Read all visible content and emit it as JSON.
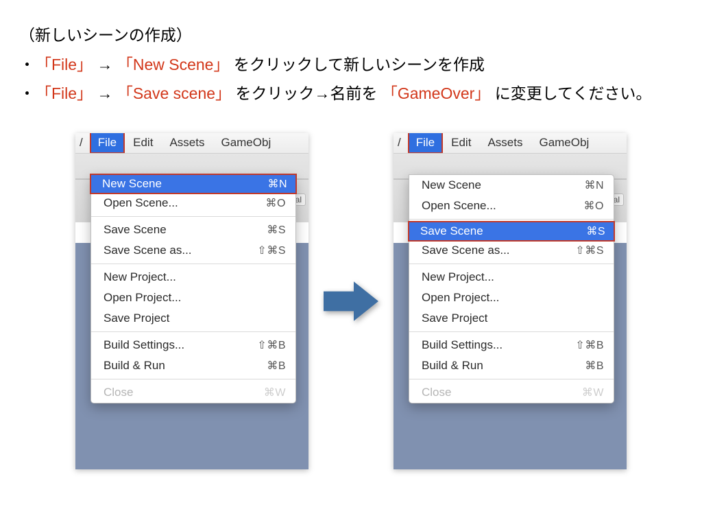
{
  "instructions": {
    "title": "（新しいシーンの作成）",
    "line1": {
      "p1": "「File」",
      "arrow1": "→",
      "p2": "「New Scene」",
      "p3": "をクリックして新しいシーンを作成"
    },
    "line2": {
      "p1": "「File」",
      "arrow1": "→",
      "p2": "「Save scene」",
      "p3": "をクリック→名前を",
      "p4": "「GameOver」",
      "p5": "に変更してください。"
    }
  },
  "menubar": {
    "slice": "/",
    "file": "File",
    "edit": "Edit",
    "assets": "Assets",
    "gameobj": "GameObj"
  },
  "toolstrip": {
    "cal": "cal"
  },
  "menuLeft": {
    "newScene": {
      "label": "New Scene",
      "shortcut": "⌘N"
    },
    "openScene": {
      "label": "Open Scene...",
      "shortcut": "⌘O"
    },
    "saveScene": {
      "label": "Save Scene",
      "shortcut": "⌘S"
    },
    "saveSceneAs": {
      "label": "Save Scene as...",
      "shortcut": "⇧⌘S"
    },
    "newProject": {
      "label": "New Project...",
      "shortcut": ""
    },
    "openProject": {
      "label": "Open Project...",
      "shortcut": ""
    },
    "saveProject": {
      "label": "Save Project",
      "shortcut": ""
    },
    "buildSettings": {
      "label": "Build Settings...",
      "shortcut": "⇧⌘B"
    },
    "buildRun": {
      "label": "Build & Run",
      "shortcut": "⌘B"
    },
    "close": {
      "label": "Close",
      "shortcut": "⌘W"
    }
  },
  "menuRight": {
    "newScene": {
      "label": "New Scene",
      "shortcut": "⌘N"
    },
    "openScene": {
      "label": "Open Scene...",
      "shortcut": "⌘O"
    },
    "saveScene": {
      "label": "Save Scene",
      "shortcut": "⌘S"
    },
    "saveSceneAs": {
      "label": "Save Scene as...",
      "shortcut": "⇧⌘S"
    },
    "newProject": {
      "label": "New Project...",
      "shortcut": ""
    },
    "openProject": {
      "label": "Open Project...",
      "shortcut": ""
    },
    "saveProject": {
      "label": "Save Project",
      "shortcut": ""
    },
    "buildSettings": {
      "label": "Build Settings...",
      "shortcut": "⇧⌘B"
    },
    "buildRun": {
      "label": "Build & Run",
      "shortcut": "⌘B"
    },
    "close": {
      "label": "Close",
      "shortcut": "⌘W"
    }
  },
  "colors": {
    "arrow": "#3f6fa3"
  }
}
